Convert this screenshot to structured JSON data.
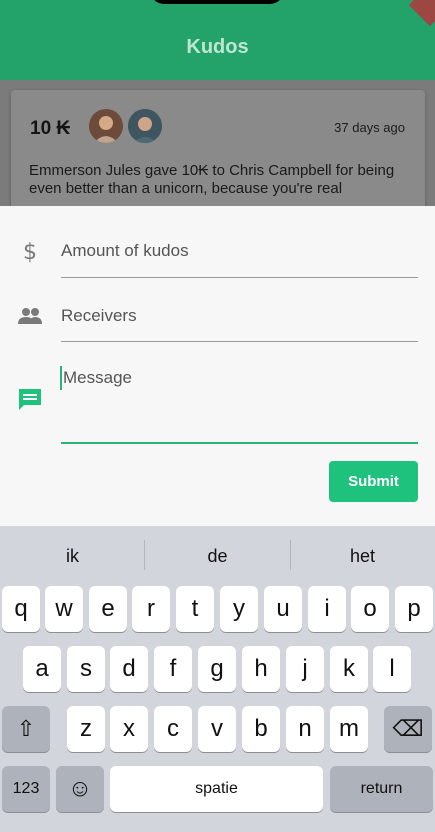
{
  "header": {
    "title": "Kudos"
  },
  "card": {
    "amount": "10 ₭",
    "time_ago": "37 days ago",
    "message": "Emmerson Jules gave 10₭ to Chris Campbell for being even better than a unicorn, because you're real"
  },
  "form": {
    "amount_placeholder": "Amount of kudos",
    "receivers_placeholder": "Receivers",
    "message_placeholder": "Message",
    "submit_label": "Submit",
    "accent_color": "#1fc27d"
  },
  "keyboard": {
    "suggestions": [
      "ik",
      "de",
      "het"
    ],
    "row1": [
      "q",
      "w",
      "e",
      "r",
      "t",
      "y",
      "u",
      "i",
      "o",
      "p"
    ],
    "row2": [
      "a",
      "s",
      "d",
      "f",
      "g",
      "h",
      "j",
      "k",
      "l"
    ],
    "row3": [
      "z",
      "x",
      "c",
      "v",
      "b",
      "n",
      "m"
    ],
    "numbers_label": "123",
    "space_label": "spatie",
    "return_label": "return",
    "shift_icon": "⇧",
    "backspace_icon": "⌫",
    "emoji_icon": "☺"
  }
}
